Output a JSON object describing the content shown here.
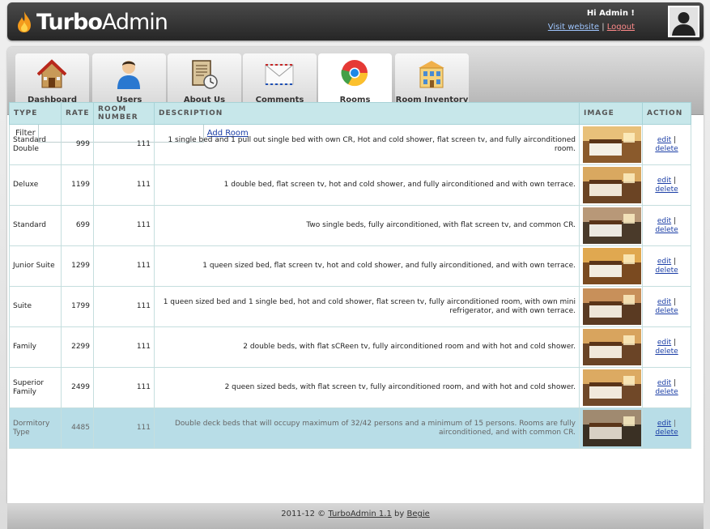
{
  "app": {
    "logo_bold": "Turbo",
    "logo_light": "Admin",
    "greeting": "Hi Admin !",
    "visit_link": "Visit website",
    "separator": "|",
    "logout_link": "Logout"
  },
  "nav": {
    "tabs": [
      {
        "label": "Dashboard",
        "icon": "house-icon",
        "active": false
      },
      {
        "label": "Users",
        "icon": "user-icon",
        "active": false
      },
      {
        "label": "About Us",
        "icon": "document-clock-icon",
        "active": false
      },
      {
        "label": "Comments",
        "icon": "envelope-icon",
        "active": false
      },
      {
        "label": "Rooms",
        "icon": "chrome-ball-icon",
        "active": true
      },
      {
        "label": "Room Inventory",
        "icon": "building-icon",
        "active": false
      }
    ]
  },
  "filter": {
    "label": "Filter",
    "value": "",
    "add_link": "Add Room"
  },
  "table": {
    "headers": {
      "type": "TYPE",
      "rate": "RATE",
      "room_number": "ROOM NUMBER",
      "description": "DESCRIPTION",
      "image": "IMAGE",
      "action": "ACTION"
    },
    "edit_label": "edit",
    "delete_label": "delete",
    "action_separator": "|",
    "rows": [
      {
        "type": "Standard Double",
        "rate": "999",
        "room_number": "111",
        "description": "1 single bed and 1 pull out single bed with own CR, Hot and cold shower, flat screen tv, and fully airconditioned room."
      },
      {
        "type": "Deluxe",
        "rate": "1199",
        "room_number": "111",
        "description": "1 double bed, flat screen tv, hot and cold shower, and fully airconditioned and with own terrace."
      },
      {
        "type": "Standard",
        "rate": "699",
        "room_number": "111",
        "description": "Two single beds, fully airconditioned, with flat screen tv, and common CR."
      },
      {
        "type": "Junior Suite",
        "rate": "1299",
        "room_number": "111",
        "description": "1 queen sized bed, flat screen tv, hot and cold shower, and fully airconditioned, and with own terrace."
      },
      {
        "type": "Suite",
        "rate": "1799",
        "room_number": "111",
        "description": "1 queen sized bed and 1 single bed, hot and cold shower, flat screen tv, fully airconditioned room, with own mini refrigerator, and with own terrace."
      },
      {
        "type": "Family",
        "rate": "2299",
        "room_number": "111",
        "description": "2 double beds, with flat sCReen tv, fully airconditioned room and with hot and cold shower."
      },
      {
        "type": "Superior Family",
        "rate": "2499",
        "room_number": "111",
        "description": "2 queen sized beds, with flat screen tv, fully airconditioned room, and with hot and cold shower."
      },
      {
        "type": "Dormitory Type",
        "rate": "4485",
        "room_number": "111",
        "description": "Double deck beds that will occupy maximum of 32/42 persons and a minimum of 15 persons. Rooms are fully airconditioned, and with common CR.",
        "highlighted": true
      }
    ]
  },
  "footer": {
    "years": "2011-12 ©",
    "product_link": "TurboAdmin 1.1",
    "by": "by",
    "author_link": "Begie"
  },
  "colors": {
    "header_bg": "#333333",
    "table_header_bg": "#c7e7ea",
    "highlight_row": "#b8dde7",
    "link": "#1b3ea6",
    "logout": "#ff8a8a"
  }
}
